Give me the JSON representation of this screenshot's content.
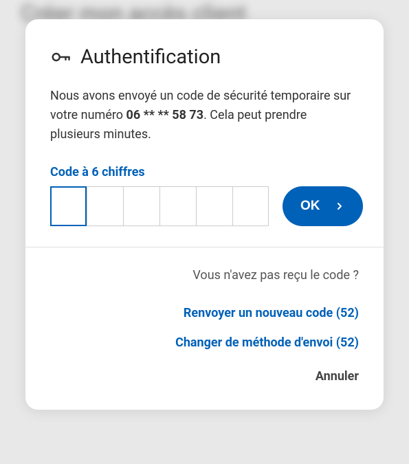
{
  "background_title": "Créer mon accès client",
  "modal": {
    "title": "Authentification",
    "description_prefix": "Nous avons envoyé un code de sécurité temporaire sur votre numéro ",
    "phone_masked": "06 ** ** 58 73",
    "description_suffix": ". Cela peut prendre plusieurs minutes.",
    "code_label": "Code à 6 chiffres",
    "ok_label": "OK",
    "code_values": [
      "",
      "",
      "",
      "",
      "",
      ""
    ]
  },
  "footer": {
    "not_received": "Vous n'avez pas reçu le code ?",
    "resend_label": "Renvoyer un nouveau code (52)",
    "change_method_label": "Changer de méthode d'envoi (52)",
    "cancel_label": "Annuler",
    "countdown_seconds": 52
  },
  "colors": {
    "accent": "#0061b8"
  }
}
